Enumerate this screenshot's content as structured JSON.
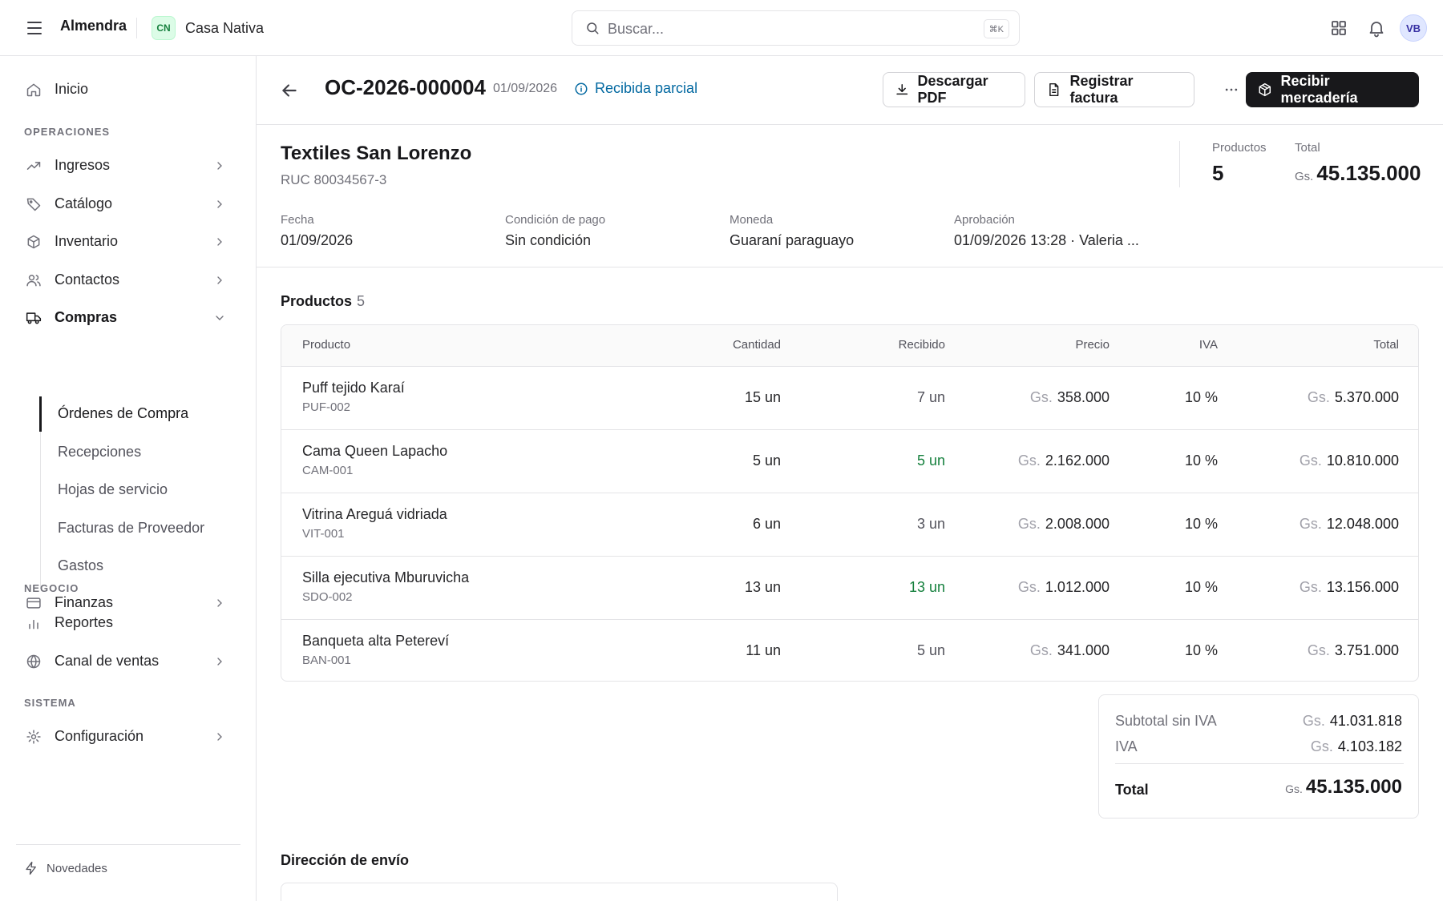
{
  "topbar": {
    "brand": "Almendra",
    "workspace_initials": "CN",
    "workspace_name": "Casa Nativa",
    "search_placeholder": "Buscar...",
    "search_shortcut": "⌘K",
    "avatar_initials": "VB"
  },
  "sidebar": {
    "home": "Inicio",
    "section_operaciones": "OPERACIONES",
    "ingresos": "Ingresos",
    "catalogo": "Catálogo",
    "inventario": "Inventario",
    "contactos": "Contactos",
    "compras": "Compras",
    "sub": [
      "Órdenes de Compra",
      "Recepciones",
      "Hojas de servicio",
      "Facturas de Proveedor",
      "Gastos"
    ],
    "finanzas": "Finanzas",
    "section_negocio": "NEGOCIO",
    "reportes": "Reportes",
    "canal": "Canal de ventas",
    "section_sistema": "SISTEMA",
    "configuracion": "Configuración",
    "novedades": "Novedades"
  },
  "header": {
    "order_id": "OC-2026-000004",
    "date": "01/09/2026",
    "status": "Recibida parcial",
    "download_pdf": "Descargar PDF",
    "register_invoice": "Registrar factura",
    "more": "···",
    "receive": "Recibir mercadería"
  },
  "supplier": {
    "name": "Textiles San Lorenzo",
    "ruc": "RUC 80034567-3",
    "products_label": "Productos",
    "products_count": "5",
    "total_label": "Total",
    "total_currency": "Gs.",
    "total_value": "45.135.000"
  },
  "meta": {
    "fecha_label": "Fecha",
    "fecha": "01/09/2026",
    "condicion_label": "Condición de pago",
    "condicion": "Sin condición",
    "moneda_label": "Moneda",
    "moneda": "Guaraní paraguayo",
    "aprobacion_label": "Aprobación",
    "aprobacion": "01/09/2026 13:28 · Valeria ..."
  },
  "products": {
    "title": "Productos",
    "count": "5",
    "columns": [
      "Producto",
      "Cantidad",
      "Recibido",
      "Precio",
      "IVA",
      "Total"
    ],
    "currency": "Gs.",
    "rows": [
      {
        "name": "Puff tejido Karaí",
        "sku": "PUF-002",
        "qty": "15 un",
        "received": "7 un",
        "price": "358.000",
        "iva": "10 %",
        "total": "5.370.000"
      },
      {
        "name": "Cama Queen Lapacho",
        "sku": "CAM-001",
        "qty": "5 un",
        "received": "5 un",
        "price": "2.162.000",
        "iva": "10 %",
        "total": "10.810.000"
      },
      {
        "name": "Vitrina Areguá vidriada",
        "sku": "VIT-001",
        "qty": "6 un",
        "received": "3 un",
        "price": "2.008.000",
        "iva": "10 %",
        "total": "12.048.000"
      },
      {
        "name": "Silla ejecutiva Mburuvicha",
        "sku": "SDO-002",
        "qty": "13 un",
        "received": "13 un",
        "price": "1.012.000",
        "iva": "10 %",
        "total": "13.156.000"
      },
      {
        "name": "Banqueta alta Petereví",
        "sku": "BAN-001",
        "qty": "11 un",
        "received": "5 un",
        "price": "341.000",
        "iva": "10 %",
        "total": "3.751.000"
      }
    ]
  },
  "summary": {
    "subtotal_label": "Subtotal sin IVA",
    "subtotal": "41.031.818",
    "iva_label": "IVA",
    "iva": "4.103.182",
    "total_label": "Total",
    "total": "45.135.000",
    "currency": "Gs."
  },
  "shipping": {
    "title": "Dirección de envío"
  },
  "colors": {
    "primary": "#18181b",
    "status_blue": "#0369a1",
    "received_green": "#15803d"
  }
}
